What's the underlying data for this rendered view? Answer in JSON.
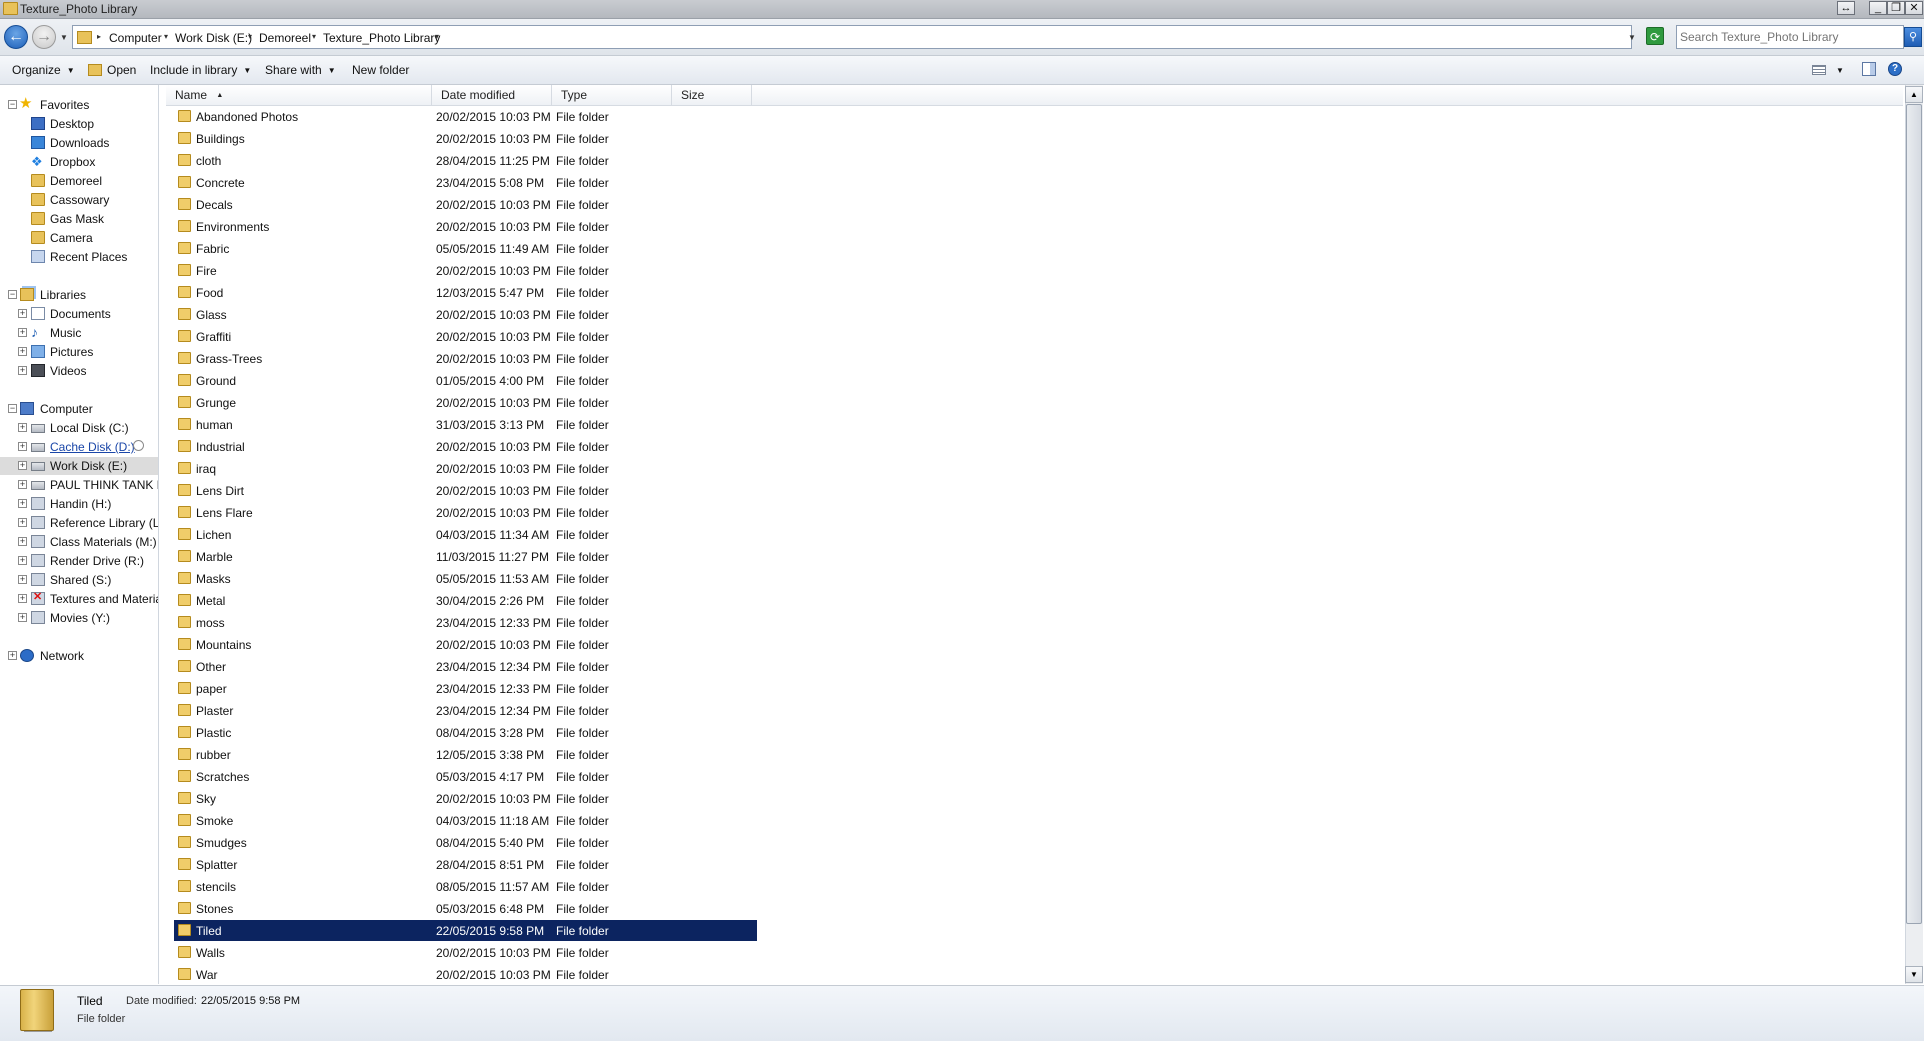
{
  "window": {
    "title": "Texture_Photo Library"
  },
  "address": {
    "crumbs": [
      "Computer",
      "Work Disk (E:)",
      "Demoreel",
      "Texture_Photo Library"
    ],
    "search_placeholder": "Search Texture_Photo Library"
  },
  "toolbar": {
    "organize": "Organize",
    "open": "Open",
    "include": "Include in library",
    "share": "Share with",
    "new_folder": "New folder"
  },
  "nav": {
    "favorites": {
      "label": "Favorites",
      "items": [
        "Desktop",
        "Downloads",
        "Dropbox",
        "Demoreel",
        "Cassowary",
        "Gas Mask",
        "Camera",
        "Recent Places"
      ]
    },
    "libraries": {
      "label": "Libraries",
      "items": [
        "Documents",
        "Music",
        "Pictures",
        "Videos"
      ]
    },
    "computer": {
      "label": "Computer",
      "items": [
        "Local Disk (C:)",
        "Cache Disk (D:)",
        "Work Disk (E:)",
        "PAUL THINK TANK DRI",
        "Handin (H:)",
        "Reference Library (L:)",
        "Class Materials (M:)",
        "Render Drive (R:)",
        "Shared (S:)",
        "Textures and Materials",
        "Movies (Y:)"
      ]
    },
    "network": {
      "label": "Network"
    }
  },
  "columns": {
    "name": "Name",
    "date": "Date modified",
    "type": "Type",
    "size": "Size"
  },
  "files": [
    {
      "name": "Abandoned Photos",
      "date": "20/02/2015 10:03 PM",
      "type": "File folder"
    },
    {
      "name": "Buildings",
      "date": "20/02/2015 10:03 PM",
      "type": "File folder"
    },
    {
      "name": "cloth",
      "date": "28/04/2015 11:25 PM",
      "type": "File folder"
    },
    {
      "name": "Concrete",
      "date": "23/04/2015 5:08 PM",
      "type": "File folder"
    },
    {
      "name": "Decals",
      "date": "20/02/2015 10:03 PM",
      "type": "File folder"
    },
    {
      "name": "Environments",
      "date": "20/02/2015 10:03 PM",
      "type": "File folder"
    },
    {
      "name": "Fabric",
      "date": "05/05/2015 11:49 AM",
      "type": "File folder"
    },
    {
      "name": "Fire",
      "date": "20/02/2015 10:03 PM",
      "type": "File folder"
    },
    {
      "name": "Food",
      "date": "12/03/2015 5:47 PM",
      "type": "File folder"
    },
    {
      "name": "Glass",
      "date": "20/02/2015 10:03 PM",
      "type": "File folder"
    },
    {
      "name": "Graffiti",
      "date": "20/02/2015 10:03 PM",
      "type": "File folder"
    },
    {
      "name": "Grass-Trees",
      "date": "20/02/2015 10:03 PM",
      "type": "File folder"
    },
    {
      "name": "Ground",
      "date": "01/05/2015 4:00 PM",
      "type": "File folder"
    },
    {
      "name": "Grunge",
      "date": "20/02/2015 10:03 PM",
      "type": "File folder"
    },
    {
      "name": "human",
      "date": "31/03/2015 3:13 PM",
      "type": "File folder"
    },
    {
      "name": "Industrial",
      "date": "20/02/2015 10:03 PM",
      "type": "File folder"
    },
    {
      "name": "iraq",
      "date": "20/02/2015 10:03 PM",
      "type": "File folder"
    },
    {
      "name": "Lens Dirt",
      "date": "20/02/2015 10:03 PM",
      "type": "File folder"
    },
    {
      "name": "Lens Flare",
      "date": "20/02/2015 10:03 PM",
      "type": "File folder"
    },
    {
      "name": "Lichen",
      "date": "04/03/2015 11:34 AM",
      "type": "File folder"
    },
    {
      "name": "Marble",
      "date": "11/03/2015 11:27 PM",
      "type": "File folder"
    },
    {
      "name": "Masks",
      "date": "05/05/2015 11:53 AM",
      "type": "File folder"
    },
    {
      "name": "Metal",
      "date": "30/04/2015 2:26 PM",
      "type": "File folder"
    },
    {
      "name": "moss",
      "date": "23/04/2015 12:33 PM",
      "type": "File folder"
    },
    {
      "name": "Mountains",
      "date": "20/02/2015 10:03 PM",
      "type": "File folder"
    },
    {
      "name": "Other",
      "date": "23/04/2015 12:34 PM",
      "type": "File folder"
    },
    {
      "name": "paper",
      "date": "23/04/2015 12:33 PM",
      "type": "File folder"
    },
    {
      "name": "Plaster",
      "date": "23/04/2015 12:34 PM",
      "type": "File folder"
    },
    {
      "name": "Plastic",
      "date": "08/04/2015 3:28 PM",
      "type": "File folder"
    },
    {
      "name": "rubber",
      "date": "12/05/2015 3:38 PM",
      "type": "File folder"
    },
    {
      "name": "Scratches",
      "date": "05/03/2015 4:17 PM",
      "type": "File folder"
    },
    {
      "name": "Sky",
      "date": "20/02/2015 10:03 PM",
      "type": "File folder"
    },
    {
      "name": "Smoke",
      "date": "04/03/2015 11:18 AM",
      "type": "File folder"
    },
    {
      "name": "Smudges",
      "date": "08/04/2015 5:40 PM",
      "type": "File folder"
    },
    {
      "name": "Splatter",
      "date": "28/04/2015 8:51 PM",
      "type": "File folder"
    },
    {
      "name": "stencils",
      "date": "08/05/2015 11:57 AM",
      "type": "File folder"
    },
    {
      "name": "Stones",
      "date": "05/03/2015 6:48 PM",
      "type": "File folder"
    },
    {
      "name": "Tiled",
      "date": "22/05/2015 9:58 PM",
      "type": "File folder",
      "selected": true
    },
    {
      "name": "Walls",
      "date": "20/02/2015 10:03 PM",
      "type": "File folder"
    },
    {
      "name": "War",
      "date": "20/02/2015 10:03 PM",
      "type": "File folder"
    }
  ],
  "details": {
    "name": "Tiled",
    "date_label": "Date modified:",
    "date_value": "22/05/2015 9:58 PM",
    "type": "File folder"
  }
}
